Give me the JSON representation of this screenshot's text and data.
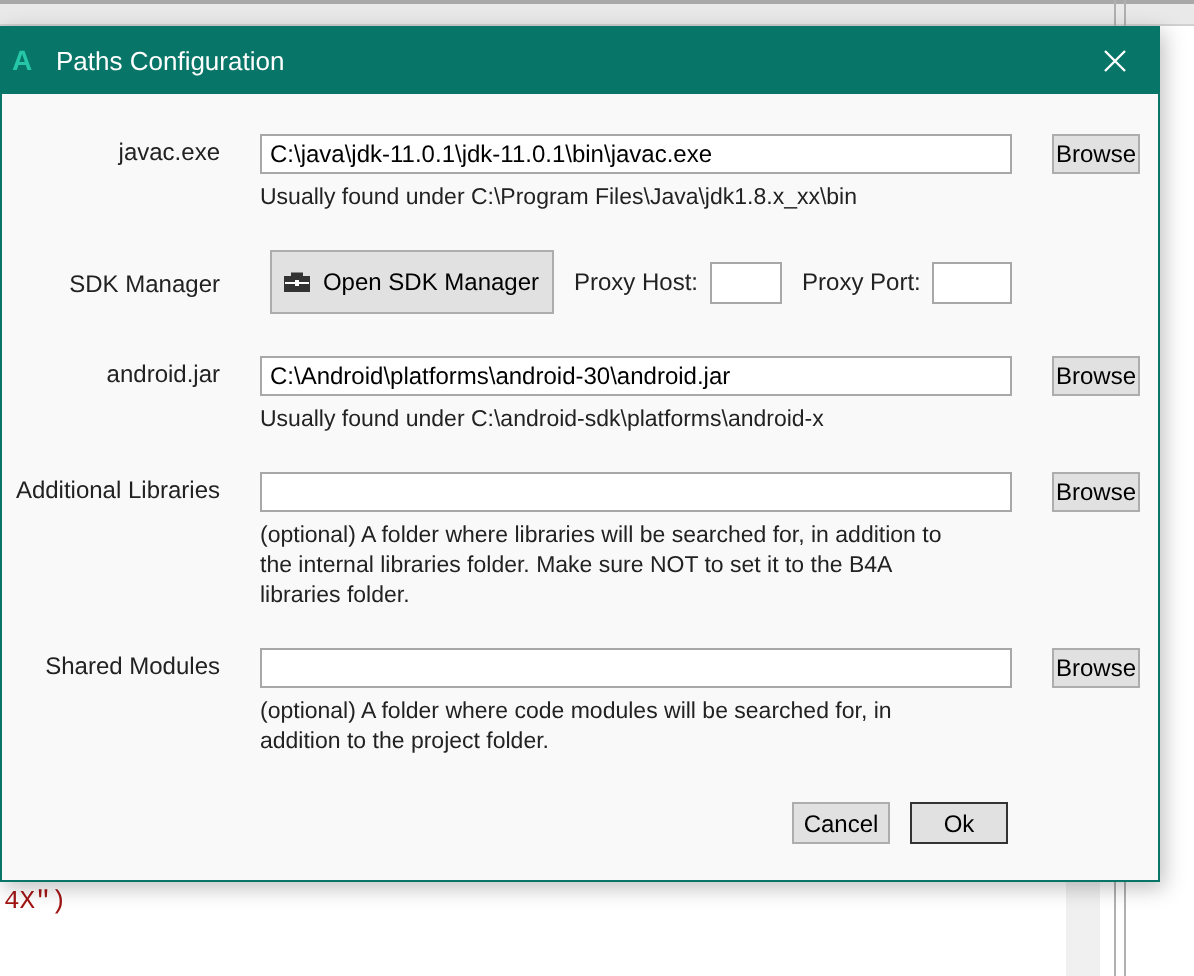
{
  "background": {
    "code_text": "4X\")"
  },
  "window": {
    "app_letter": "A",
    "title": "Paths Configuration"
  },
  "rows": [
    {
      "kind": "path",
      "label": "javac.exe",
      "value": "C:\\java\\jdk-11.0.1\\jdk-11.0.1\\bin\\javac.exe",
      "button": "Browse",
      "hint": "Usually found under C:\\Program Files\\Java\\jdk1.8.x_xx\\bin"
    },
    {
      "kind": "sdk",
      "label": "SDK Manager",
      "button": "Open SDK Manager",
      "fields": [
        {
          "label": "Proxy Host:"
        },
        {
          "label": "Proxy Port:"
        }
      ]
    },
    {
      "kind": "path",
      "label": "android.jar",
      "value": "C:\\Android\\platforms\\android-30\\android.jar",
      "button": "Browse",
      "hint": "Usually found under C:\\android-sdk\\platforms\\android-x"
    },
    {
      "kind": "path",
      "label": "Additional Libraries",
      "button": "Browse",
      "hint": "(optional) A folder where libraries will be searched for, in addition to the internal libraries folder. Make sure NOT to set it to the B4A libraries folder."
    },
    {
      "kind": "path",
      "label": "Shared Modules",
      "button": "Browse",
      "hint": "(optional) A folder where code modules will be searched for, in addition to the project folder."
    }
  ],
  "buttons": [
    {
      "label": "Cancel",
      "default": false
    },
    {
      "label": "Ok",
      "default": true
    }
  ]
}
